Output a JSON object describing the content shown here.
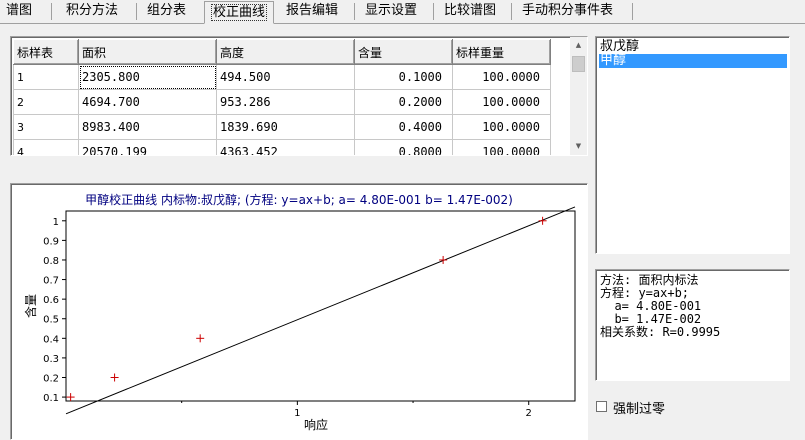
{
  "tabs": [
    {
      "label": "谱图",
      "active": false
    },
    {
      "label": "积分方法",
      "active": false
    },
    {
      "label": "组分表",
      "active": false
    },
    {
      "label": "校正曲线",
      "active": true
    },
    {
      "label": "报告编辑",
      "active": false
    },
    {
      "label": "显示设置",
      "active": false
    },
    {
      "label": "比较谱图",
      "active": false
    },
    {
      "label": "手动积分事件表",
      "active": false
    }
  ],
  "table": {
    "columns": [
      "标样表",
      "面积",
      "高度",
      "含量",
      "标样重量"
    ],
    "rows": [
      [
        "1",
        "2305.800",
        "494.500",
        "0.1000",
        "100.0000"
      ],
      [
        "2",
        "4694.700",
        "953.286",
        "0.2000",
        "100.0000"
      ],
      [
        "3",
        "8983.400",
        "1839.690",
        "0.4000",
        "100.0000"
      ],
      [
        "4",
        "20570.199",
        "4363.452",
        "0.8000",
        "100.0000"
      ]
    ]
  },
  "components": [
    {
      "label": "叔戊醇",
      "selected": false
    },
    {
      "label": "甲醇",
      "selected": true
    }
  ],
  "info": [
    "方法: 面积内标法",
    "方程: y=ax+b;",
    "  a= 4.80E-001",
    "  b= 1.47E-002",
    "相关系数: R=0.9995"
  ],
  "force_zero": {
    "label": "强制过零",
    "checked": false
  },
  "chart_data": {
    "type": "scatter",
    "title": "甲醇校正曲线 内标物:叔戊醇; (方程: y=ax+b; a= 4.80E-001 b= 1.47E-002)",
    "xlabel": "响应",
    "ylabel": "含量",
    "xlim": [
      0,
      2.2
    ],
    "ylim": [
      0.08,
      1.05
    ],
    "xticks": [
      1,
      2
    ],
    "yticks": [
      0.1,
      0.2,
      0.3,
      0.4,
      0.5,
      0.6,
      0.7,
      0.8,
      0.9,
      1
    ],
    "points": [
      {
        "x": 0.02,
        "y": 0.1
      },
      {
        "x": 0.21,
        "y": 0.2
      },
      {
        "x": 0.58,
        "y": 0.4
      },
      {
        "x": 1.63,
        "y": 0.8
      },
      {
        "x": 2.06,
        "y": 1.0
      }
    ],
    "fit_line": {
      "a": 0.48,
      "b": 0.0147
    },
    "point_color": "#cc0000",
    "line_color": "#000000",
    "title_color": "#000080"
  }
}
